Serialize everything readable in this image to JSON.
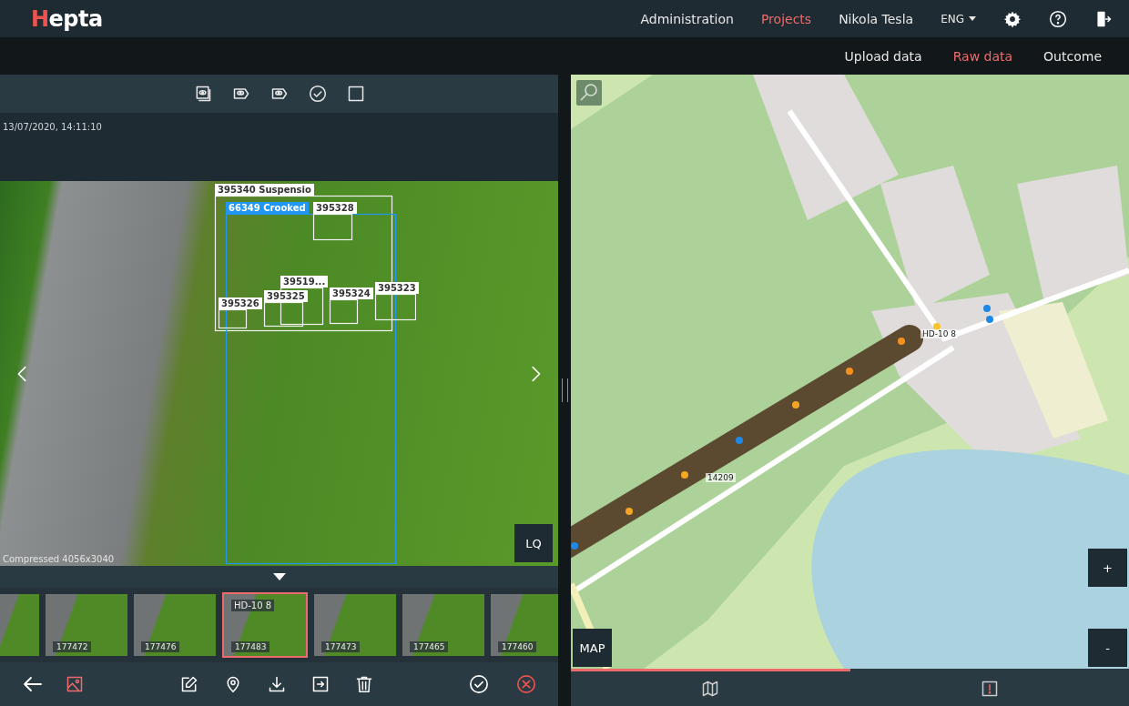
{
  "header": {
    "logo": "Hepta",
    "nav": [
      {
        "label": "Administration",
        "selected": false
      },
      {
        "label": "Projects",
        "selected": true
      },
      {
        "label": "Nikola Tesla",
        "selected": false
      }
    ],
    "language": "ENG"
  },
  "subnav": [
    {
      "label": "Upload data",
      "selected": false
    },
    {
      "label": "Raw data",
      "selected": true
    },
    {
      "label": "Outcome",
      "selected": false
    }
  ],
  "viewer": {
    "timestamp": "13/07/2020, 14:11:10",
    "image_info": "Compressed 4056x3040",
    "quality_button": "LQ",
    "annotations": [
      {
        "label": "395340 Suspensio",
        "kind": "plain"
      },
      {
        "label": "66349 Crooked",
        "kind": "defect"
      },
      {
        "label": "395328",
        "kind": "plain"
      },
      {
        "label": "39519...",
        "kind": "plain"
      },
      {
        "label": "395326",
        "kind": "plain"
      },
      {
        "label": "395325",
        "kind": "plain"
      },
      {
        "label": "395324",
        "kind": "plain"
      },
      {
        "label": "395323",
        "kind": "plain"
      }
    ],
    "thumbnails": [
      {
        "selected": false
      },
      {
        "id": "177472",
        "selected": false
      },
      {
        "id": "177476",
        "selected": false
      },
      {
        "id": "177483",
        "title": "HD-10 8",
        "selected": true
      },
      {
        "id": "177473",
        "selected": false
      },
      {
        "id": "177465",
        "selected": false
      },
      {
        "id": "177460",
        "selected": false
      }
    ]
  },
  "map": {
    "layer_button": "MAP",
    "zoom_in": "+",
    "zoom_out": "-",
    "pole_label": "HD-10 8",
    "track_label": "14209",
    "markers": [
      {
        "color": "#f5901e"
      },
      {
        "color": "#f5901e"
      },
      {
        "color": "#f5a623"
      },
      {
        "color": "#1e88e5"
      },
      {
        "color": "#f5a623"
      },
      {
        "color": "#f5a623"
      },
      {
        "color": "#1e88e5"
      },
      {
        "color": "#f7c32e"
      },
      {
        "color": "#1e88e5"
      },
      {
        "color": "#1e88e5"
      }
    ],
    "tabs": [
      {
        "kind": "map",
        "selected": true
      },
      {
        "kind": "alert",
        "selected": false
      }
    ]
  }
}
